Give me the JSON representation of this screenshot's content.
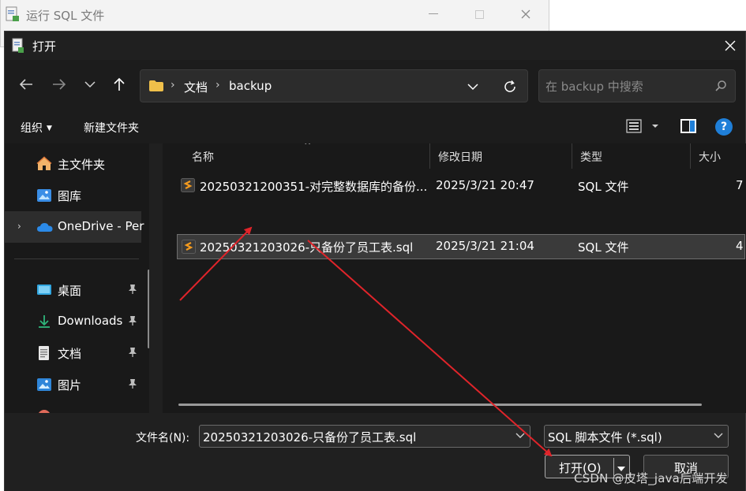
{
  "background_window": {
    "title": "运行 SQL 文件"
  },
  "dialog": {
    "title": "打开",
    "breadcrumbs": [
      "文档",
      "backup"
    ],
    "search": {
      "placeholder": "在 backup 中搜索"
    },
    "toolbar": {
      "organize": "组织",
      "new_folder": "新建文件夹",
      "help": "?"
    },
    "sidebar": {
      "items": [
        {
          "label": "主文件夹",
          "icon": "home-icon"
        },
        {
          "label": "图库",
          "icon": "gallery-icon"
        },
        {
          "label": "OneDrive - Per",
          "icon": "cloud-icon"
        },
        {
          "label": "桌面",
          "icon": "desktop-icon"
        },
        {
          "label": "Downloads",
          "icon": "download-icon"
        },
        {
          "label": "文档",
          "icon": "document-icon"
        },
        {
          "label": "图片",
          "icon": "picture-icon"
        }
      ]
    },
    "columns": [
      "名称",
      "修改日期",
      "类型",
      "大小"
    ],
    "files": [
      {
        "name": "20250321200351-对完整数据库的备份...",
        "date": "2025/3/21 20:47",
        "type": "SQL 文件",
        "size": "7",
        "selected": false
      },
      {
        "name": "20250321203026-只备份了员工表.sql",
        "date": "2025/3/21 21:04",
        "type": "SQL 文件",
        "size": "4",
        "selected": true
      }
    ],
    "footer": {
      "filename_label": "文件名(N):",
      "filename_value": "20250321203026-只备份了员工表.sql",
      "filetype": "SQL 脚本文件 (*.sql)",
      "open_label": "打开(O)",
      "cancel_label": "取消"
    }
  },
  "watermark": "CSDN @皮塔_java后端开发",
  "colors": {
    "accent": "#1f7fd8",
    "annotation_arrow": "#e0242a",
    "folder": "#f0c04a",
    "sql_icon": "#f39a1e"
  }
}
